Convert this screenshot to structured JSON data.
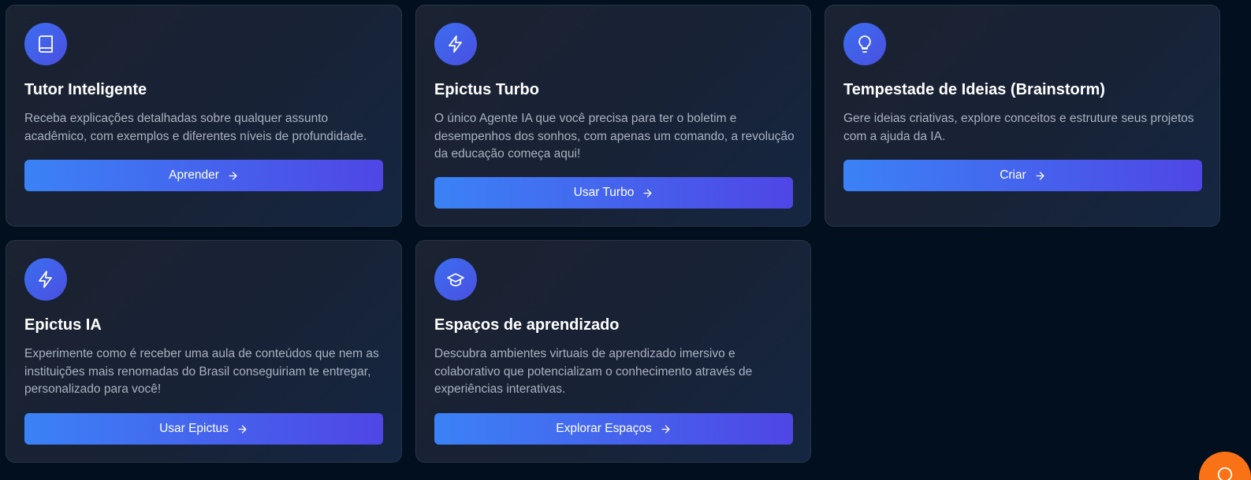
{
  "cards": [
    {
      "icon": "book-icon",
      "title": "Tutor Inteligente",
      "description": "Receba explicações detalhadas sobre qualquer assunto acadêmico, com exemplos e diferentes níveis de profundidade.",
      "button_label": "Aprender"
    },
    {
      "icon": "zap-icon",
      "title": "Epictus Turbo",
      "description": "O único Agente IA que você precisa para ter o boletim e desempenhos dos sonhos, com apenas um comando, a revolução da educação começa aqui!",
      "button_label": "Usar Turbo"
    },
    {
      "icon": "lightbulb-icon",
      "title": "Tempestade de Ideias (Brainstorm)",
      "description": "Gere ideias criativas, explore conceitos e estruture seus projetos com a ajuda da IA.",
      "button_label": "Criar"
    },
    {
      "icon": "zap-icon",
      "title": "Epictus IA",
      "description": "Experimente como é receber uma aula de conteúdos que nem as instituições mais renomadas do Brasil conseguiriam te entregar, personalizado para você!",
      "button_label": "Usar Epictus"
    },
    {
      "icon": "graduation-cap-icon",
      "title": "Espaços de aprendizado",
      "description": "Descubra ambientes virtuais de aprendizado imersivo e colaborativo que potencializam o conhecimento através de experiências interativas.",
      "button_label": "Explorar Espaços"
    }
  ],
  "colors": {
    "background": "#020f1f",
    "card_bg": "#1b2231",
    "accent_start": "#3b82f6",
    "accent_end": "#4f46e5",
    "fab": "#f97316"
  },
  "fab": {
    "icon": "help-icon"
  }
}
